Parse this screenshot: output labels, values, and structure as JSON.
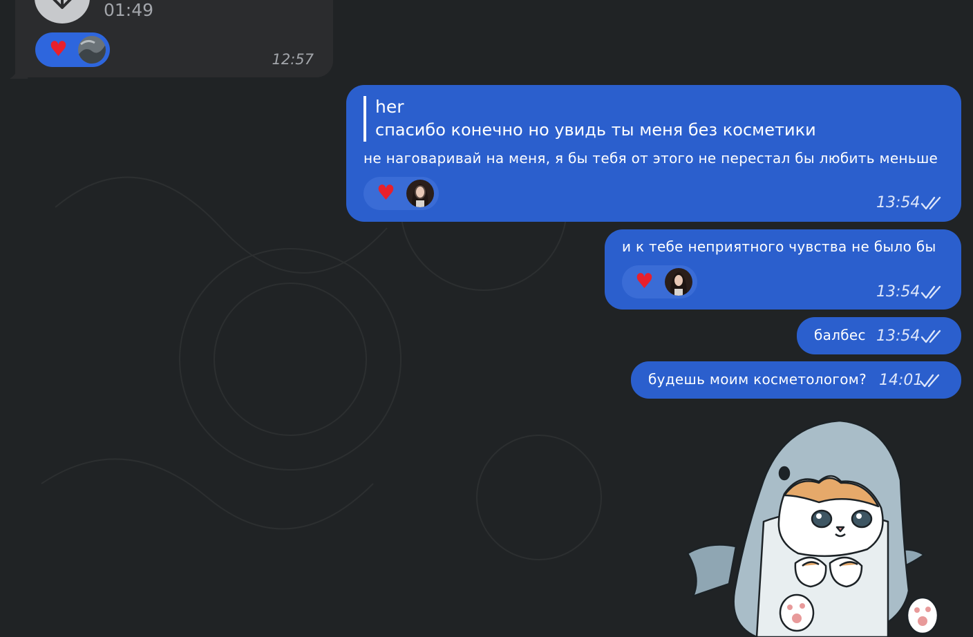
{
  "incoming_voice": {
    "duration": "01:49",
    "reaction_emoji": "♥",
    "time": "12:57"
  },
  "messages": [
    {
      "reply_author": "her",
      "reply_text": "спасибо конечно но увидь ты меня без косметики",
      "text": "не наговаривай на меня, я бы тебя от этого не перестал бы любить меньше",
      "reaction_emoji": "♥",
      "time": "13:54"
    },
    {
      "text": "и к тебе неприятного чувства не было бы",
      "reaction_emoji": "♥",
      "time": "13:54"
    },
    {
      "text": "балбес",
      "time": "13:54"
    },
    {
      "text": "будешь моим косметологом?",
      "time": "14:01"
    }
  ],
  "colors": {
    "background": "#202325",
    "outgoing_bubble": "#2b5fcd",
    "incoming_bubble": "#2b2c2e",
    "reaction_pill": "#3a6cd6",
    "heart": "#e8202c"
  },
  "icons": {
    "download": "download-icon",
    "read_receipt": "double-check-icon",
    "sticker": "shark-cat-sticker"
  }
}
